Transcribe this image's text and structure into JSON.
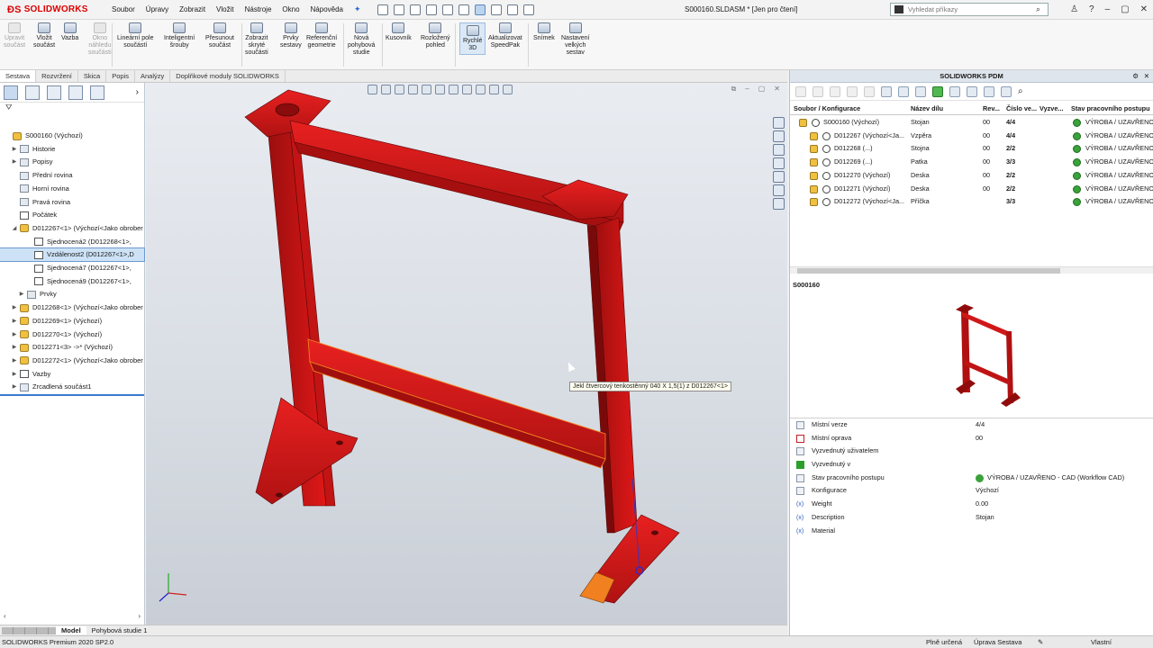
{
  "app": {
    "logo": "SOLIDWORKS",
    "menu": [
      "Soubor",
      "Úpravy",
      "Zobrazit",
      "Vložit",
      "Nástroje",
      "Okno",
      "Nápověda"
    ],
    "document_title": "S000160.SLDASM * [Jen pro čtení]",
    "search_placeholder": "Vyhledat příkazy"
  },
  "ribbon": [
    {
      "label": "Upravit\nsoučást",
      "disabled": true
    },
    {
      "label": "Vložit\nsoučást",
      "disabled": false
    },
    {
      "label": "Vazba",
      "disabled": false
    },
    {
      "label": "Okno\nnáhledu\nsoučásti",
      "disabled": true
    },
    {
      "label": "Lineární pole\nsoučástí",
      "disabled": false
    },
    {
      "label": "Inteligentní\nšrouby",
      "disabled": false
    },
    {
      "label": "Přesunout\nsoučást",
      "disabled": false
    },
    {
      "label": "Zobrazit\nskryté\nsoučásti",
      "disabled": false
    },
    {
      "label": "Prvky\nsestavy",
      "disabled": false
    },
    {
      "label": "Referenční\ngeometrie",
      "disabled": false
    },
    {
      "label": "Nová\npohybová\nstudie",
      "disabled": false
    },
    {
      "label": "Kusovník",
      "disabled": false
    },
    {
      "label": "Rozložený\npohled",
      "disabled": false
    },
    {
      "label": "Rychlé\n3D",
      "disabled": false,
      "active": true
    },
    {
      "label": "Aktualizovat\nSpeedPak",
      "disabled": false
    },
    {
      "label": "Snímek",
      "disabled": false
    },
    {
      "label": "Nastavení\nvelkých\nsestav",
      "disabled": false
    }
  ],
  "tabs": [
    "Sestava",
    "Rozvržení",
    "Skica",
    "Popis",
    "Analýzy",
    "Doplňkové moduly SOLIDWORKS"
  ],
  "tree": [
    {
      "label": "S000160  (Výchozí)",
      "indent": 0,
      "toggle": "",
      "icon": "asm"
    },
    {
      "label": "Historie",
      "indent": 1,
      "toggle": "▶",
      "icon": "plain"
    },
    {
      "label": "Popisy",
      "indent": 1,
      "toggle": "▶",
      "icon": "plain"
    },
    {
      "label": "Přední rovina",
      "indent": 1,
      "toggle": "",
      "icon": "plain"
    },
    {
      "label": "Horní rovina",
      "indent": 1,
      "toggle": "",
      "icon": "plain"
    },
    {
      "label": "Pravá rovina",
      "indent": 1,
      "toggle": "",
      "icon": "plain"
    },
    {
      "label": "Počátek",
      "indent": 1,
      "toggle": "",
      "icon": "mate"
    },
    {
      "label": "D012267<1> (Výchozí<Jako obrober",
      "indent": 1,
      "toggle": "◢",
      "icon": "asm"
    },
    {
      "label": "Sjednocená2 (D012268<1>,",
      "indent": 3,
      "toggle": "",
      "icon": "mate"
    },
    {
      "label": "Vzdálenost2 (D012267<1>,D",
      "indent": 3,
      "toggle": "",
      "icon": "mate",
      "selected": true
    },
    {
      "label": "Sjednocená7 (D012267<1>,",
      "indent": 3,
      "toggle": "",
      "icon": "mate"
    },
    {
      "label": "Sjednocená9 (D012267<1>,",
      "indent": 3,
      "toggle": "",
      "icon": "mate"
    },
    {
      "label": "Prvky",
      "indent": 2,
      "toggle": "▶",
      "icon": "plain"
    },
    {
      "label": "D012268<1> (Výchozí<Jako obrober",
      "indent": 1,
      "toggle": "▶",
      "icon": "asm"
    },
    {
      "label": "D012269<1> (Výchozí)",
      "indent": 1,
      "toggle": "▶",
      "icon": "asm"
    },
    {
      "label": "D012270<1> (Výchozí)",
      "indent": 1,
      "toggle": "▶",
      "icon": "asm"
    },
    {
      "label": "D012271<3> ->* (Výchozí)",
      "indent": 1,
      "toggle": "▶",
      "icon": "asm"
    },
    {
      "label": "D012272<1> (Výchozí<Jako obrober",
      "indent": 1,
      "toggle": "▶",
      "icon": "asm"
    },
    {
      "label": "Vazby",
      "indent": 1,
      "toggle": "▶",
      "icon": "mate"
    },
    {
      "label": "Zrcadlená součást1",
      "indent": 1,
      "toggle": "▶",
      "icon": "plain"
    }
  ],
  "viewport": {
    "tooltip": "Jekl čtvercový tenkostěnný 040 X 1,5(1) z D012267<1>"
  },
  "model_tabs": [
    "Model",
    "Pohybová studie 1"
  ],
  "status": {
    "product": "SOLIDWORKS Premium 2020 SP2.0",
    "defined": "Plně určená",
    "editing": "Úprava Sestava",
    "units": "Vlastní"
  },
  "pdm": {
    "title": "SOLIDWORKS PDM",
    "columns": [
      "Soubor / Konfigurace",
      "Název dílu",
      "Rev...",
      "Číslo ve...",
      "Vyzve...",
      "Stav pracovního postupu"
    ],
    "rows": [
      {
        "file": "S000160  (Výchozí)",
        "name": "Stojan",
        "rev": "00",
        "ver": "4/4",
        "state": "VÝROBA / UZAVŘENO"
      },
      {
        "file": "D012267  (Výchozí<Ja...",
        "name": "Vzpěra",
        "rev": "00",
        "ver": "4/4",
        "state": "VÝROBA / UZAVŘENO"
      },
      {
        "file": "D012268  (...)",
        "name": "Stojna",
        "rev": "00",
        "ver": "2/2",
        "state": "VÝROBA / UZAVŘENO"
      },
      {
        "file": "D012269  (...)",
        "name": "Patka",
        "rev": "00",
        "ver": "3/3",
        "state": "VÝROBA / UZAVŘENO"
      },
      {
        "file": "D012270  (Výchozí)",
        "name": "Deska",
        "rev": "00",
        "ver": "2/2",
        "state": "VÝROBA / UZAVŘENO"
      },
      {
        "file": "D012271  (Výchozí)",
        "name": "Deska",
        "rev": "00",
        "ver": "2/2",
        "state": "VÝROBA / UZAVŘENO"
      },
      {
        "file": "D012272  (Výchozí<Ja...",
        "name": "Příčka",
        "rev": "",
        "ver": "3/3",
        "state": "VÝROBA / UZAVŘENO"
      }
    ],
    "preview_title": "S000160",
    "properties": [
      {
        "label": "Místní verze",
        "value": "4/4",
        "icon": "plain"
      },
      {
        "label": "Místní oprava",
        "value": "00",
        "icon": "check"
      },
      {
        "label": "Vyzvednutý uživatelem",
        "value": "",
        "icon": "plain"
      },
      {
        "label": "Vyzvednutý v",
        "value": "",
        "icon": "green"
      },
      {
        "label": "Stav pracovního postupu",
        "value": "VÝROBA / UZAVŘENO - CAD (Workflow CAD)",
        "icon": "plain",
        "ok": true
      },
      {
        "label": "Konfigurace",
        "value": "Výchozí",
        "icon": "plain"
      },
      {
        "label": "Weight",
        "value": "0.00",
        "icon": "var"
      },
      {
        "label": "Description",
        "value": "Stojan",
        "icon": "var"
      },
      {
        "label": "Material",
        "value": "",
        "icon": "var"
      }
    ]
  },
  "colors": {
    "part_red": "#e01818",
    "part_dark": "#8a0c0c",
    "highlight_orange": "#f08020",
    "logo_red": "#dd0000"
  }
}
